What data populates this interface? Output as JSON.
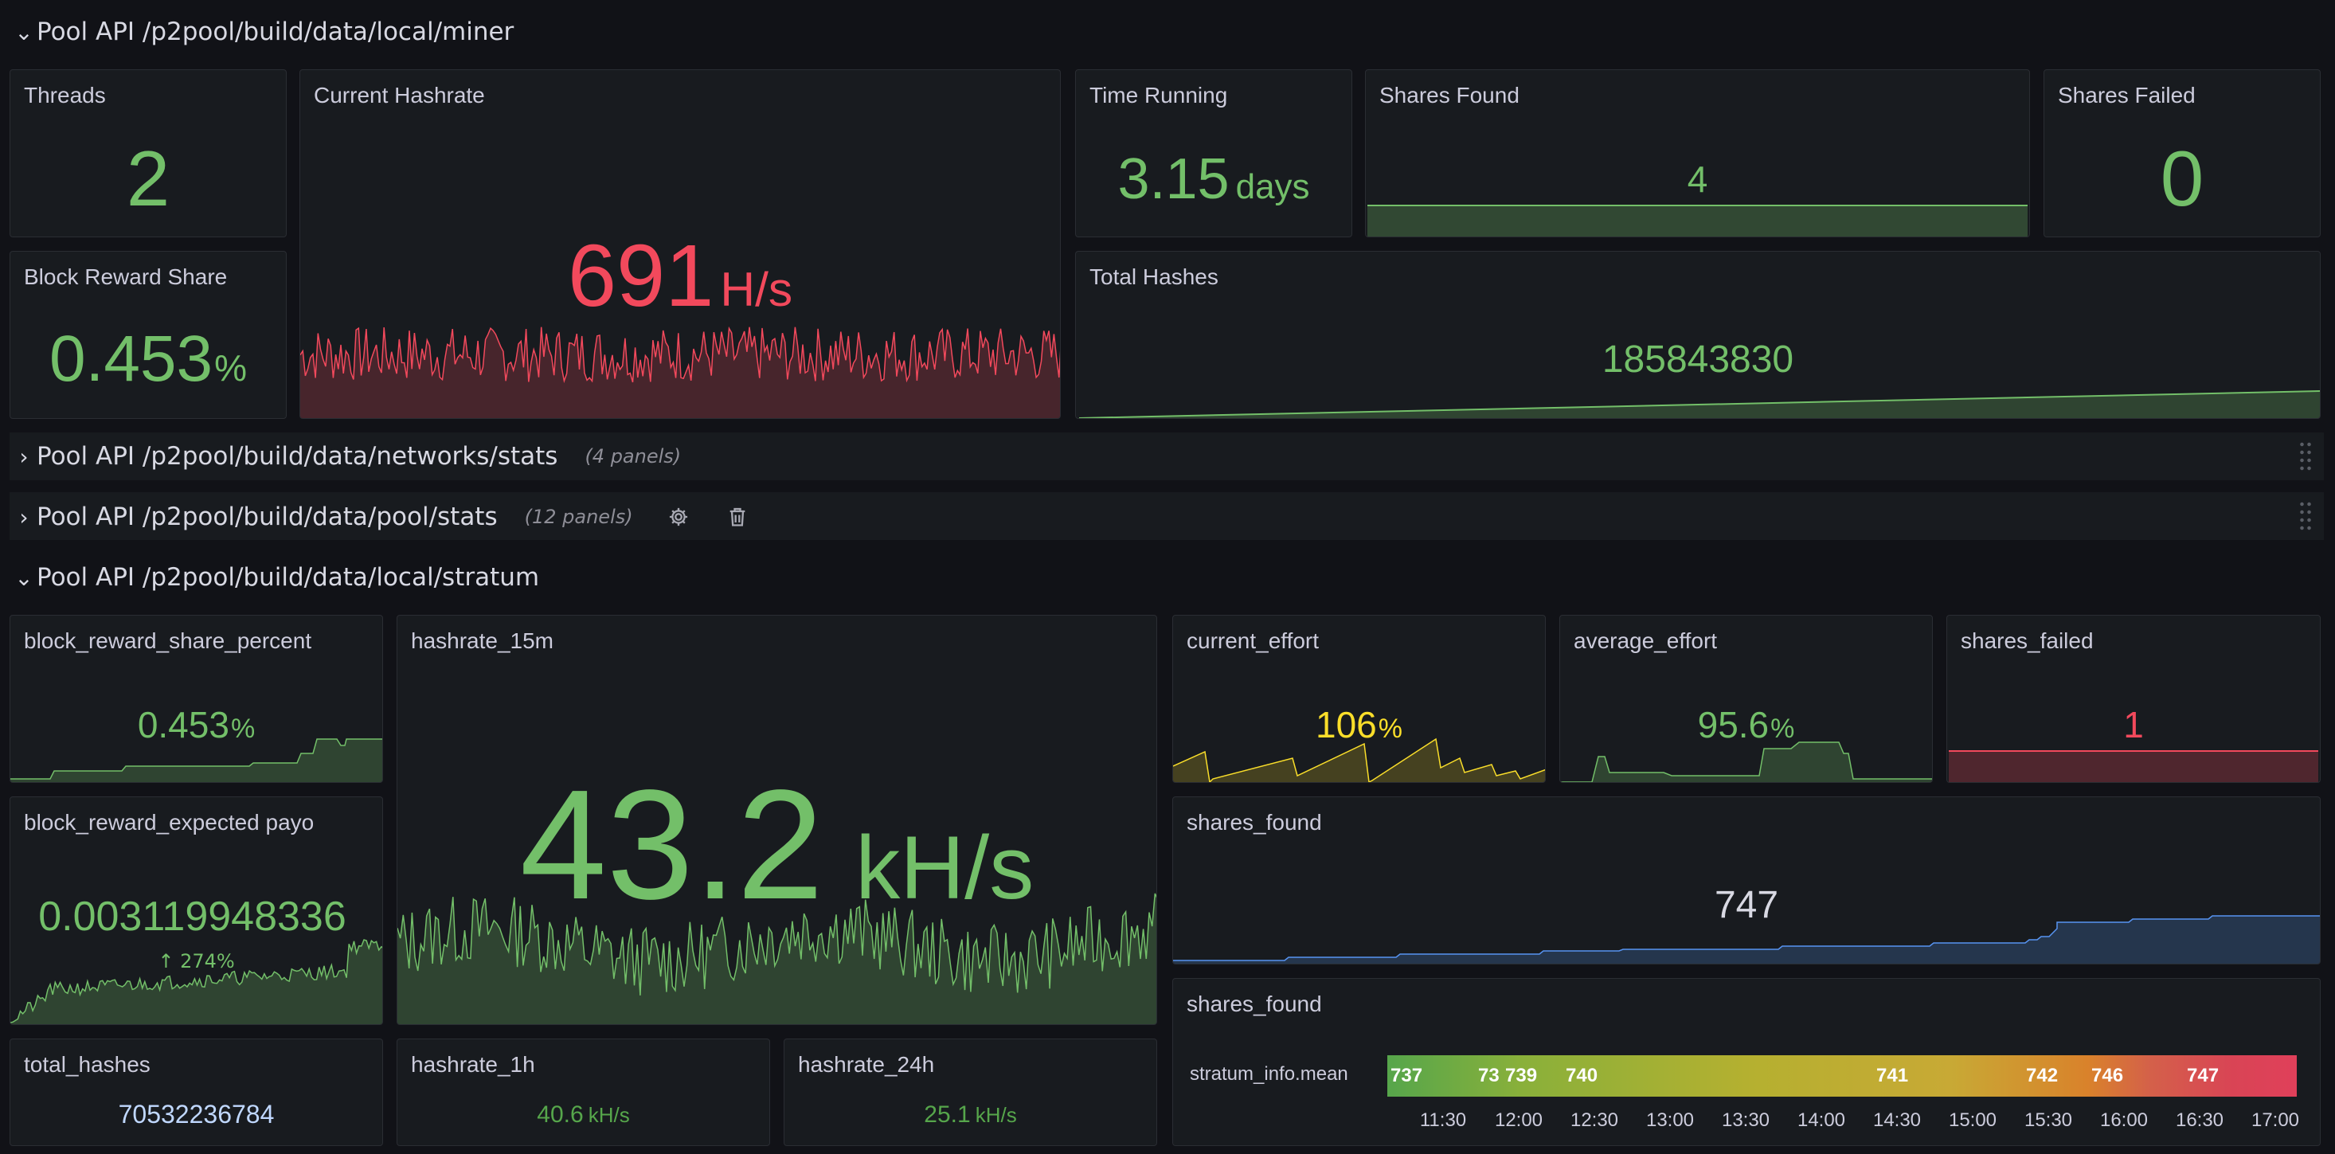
{
  "rows": {
    "miner": {
      "title": "Pool API /p2pool/build/data/local/miner",
      "collapsed": false
    },
    "networks": {
      "title": "Pool API /p2pool/build/data/networks/stats",
      "count": "(4 panels)",
      "collapsed": true
    },
    "pool": {
      "title": "Pool API /p2pool/build/data/pool/stats",
      "count": "(12 panels)",
      "collapsed": true
    },
    "stratum": {
      "title": "Pool API /p2pool/build/data/local/stratum",
      "collapsed": false
    }
  },
  "miner": {
    "threads": {
      "title": "Threads",
      "value": "2"
    },
    "current_hashrate": {
      "title": "Current Hashrate",
      "value": "691",
      "unit": "H/s"
    },
    "time_running": {
      "title": "Time Running",
      "value": "3.15",
      "unit": "days"
    },
    "shares_found": {
      "title": "Shares Found",
      "value": "4"
    },
    "shares_failed": {
      "title": "Shares Failed",
      "value": "0"
    },
    "block_reward_share": {
      "title": "Block Reward Share",
      "value": "0.453",
      "unit": "%"
    },
    "total_hashes": {
      "title": "Total Hashes",
      "value": "185843830"
    }
  },
  "stratum": {
    "brsp": {
      "title": "block_reward_share_percent",
      "value": "0.453",
      "unit": "%"
    },
    "hashrate_15m": {
      "title": "hashrate_15m",
      "value": "43.2",
      "unit": "kH/s"
    },
    "current_effort": {
      "title": "current_effort",
      "value": "106",
      "unit": "%"
    },
    "average_effort": {
      "title": "average_effort",
      "value": "95.6",
      "unit": "%"
    },
    "shares_failed": {
      "title": "shares_failed",
      "value": "1"
    },
    "brep": {
      "title": "block_reward_expected payo",
      "value": "0.003119948336",
      "change": "274%"
    },
    "shares_found": {
      "title": "shares_found",
      "value": "747"
    },
    "shares_found_timeline": {
      "title": "shares_found",
      "series_label": "stratum_info.mean",
      "segments": [
        "737",
        "73",
        "739",
        "740",
        "741",
        "742",
        "746",
        "747"
      ],
      "ticks": [
        "11:30",
        "12:00",
        "12:30",
        "13:00",
        "13:30",
        "14:00",
        "14:30",
        "15:00",
        "15:30",
        "16:00",
        "16:30",
        "17:00"
      ]
    },
    "total_hashes": {
      "title": "total_hashes",
      "value": "70532236784"
    },
    "hashrate_1h": {
      "title": "hashrate_1h",
      "value": "40.6",
      "unit": "kH/s"
    },
    "hashrate_24h": {
      "title": "hashrate_24h",
      "value": "25.1",
      "unit": "kH/s"
    }
  },
  "colors": {
    "green": "#73bf69",
    "red": "#f2495c",
    "yellow": "#fade2a",
    "blue": "#5794f2",
    "bg": "#111217",
    "panel": "#181b1f"
  },
  "icons": [
    "chevron-down-icon",
    "chevron-right-icon",
    "gear-icon",
    "trash-icon",
    "drag-handle-icon"
  ]
}
